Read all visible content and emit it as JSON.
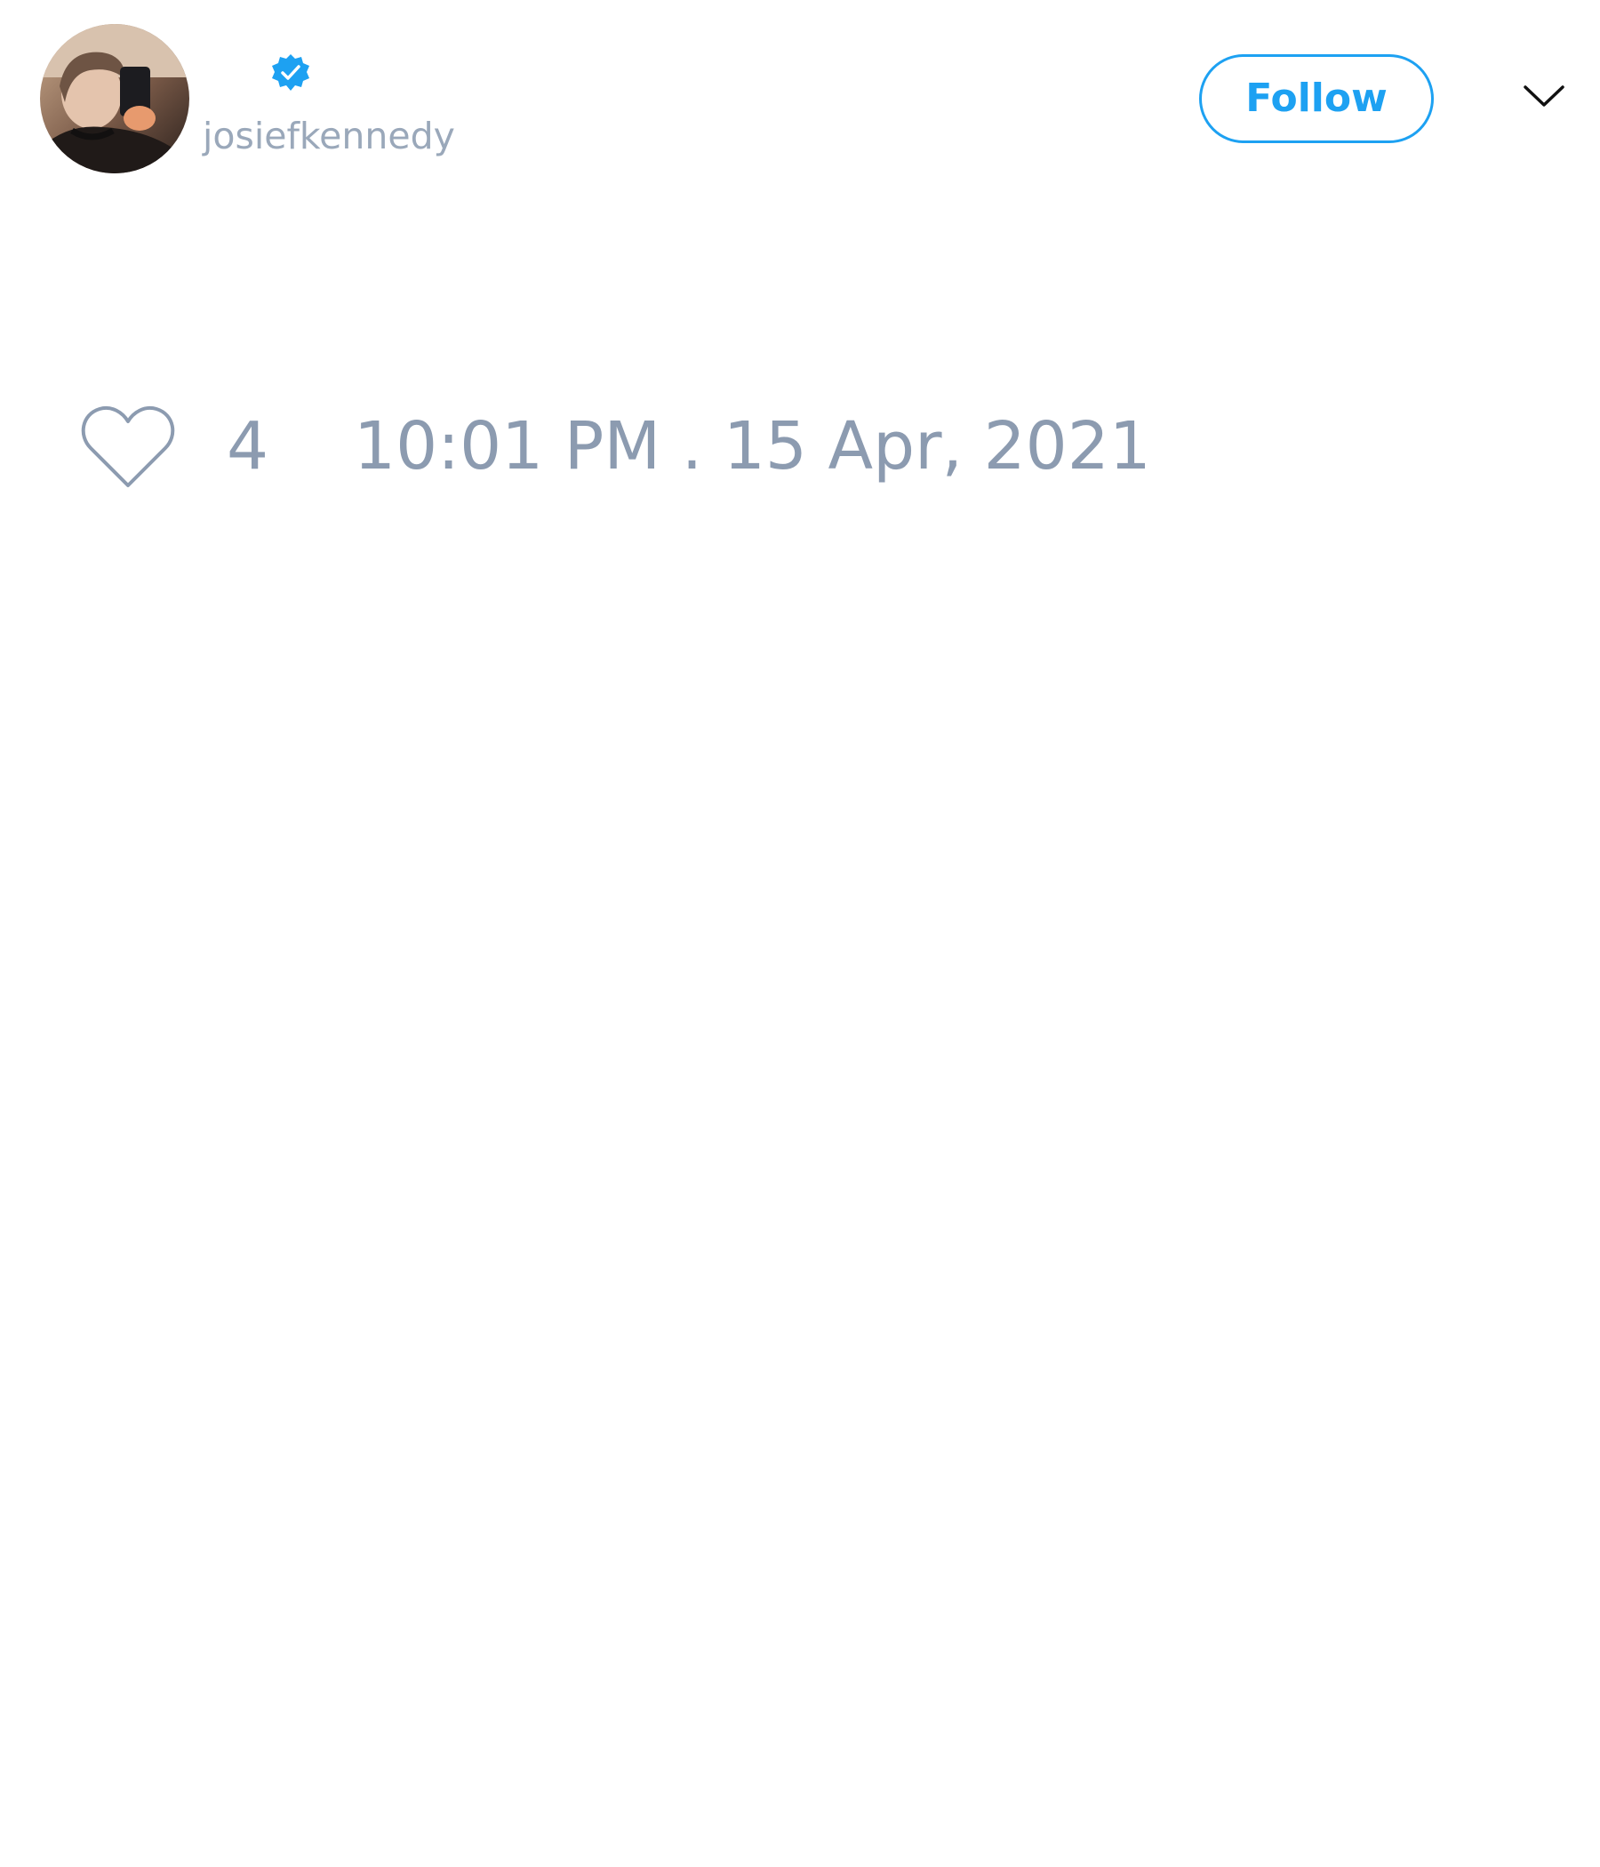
{
  "tweet": {
    "author": {
      "handle": "josiefkennedy",
      "avatar": "profile-photo",
      "verified_badge_icon": "verified-check-icon"
    },
    "header": {
      "follow_label": "Follow",
      "menu_icon": "chevron-down-icon"
    },
    "footer": {
      "like_icon": "heart-outline-icon",
      "like_count": "4",
      "timestamp": "10:01 PM . 15 Apr, 2021"
    }
  },
  "colors": {
    "accent": "#1da1f2",
    "muted_text": "#8c9bb0",
    "handle_text": "#9aa8ba",
    "background": "#ffffff"
  }
}
